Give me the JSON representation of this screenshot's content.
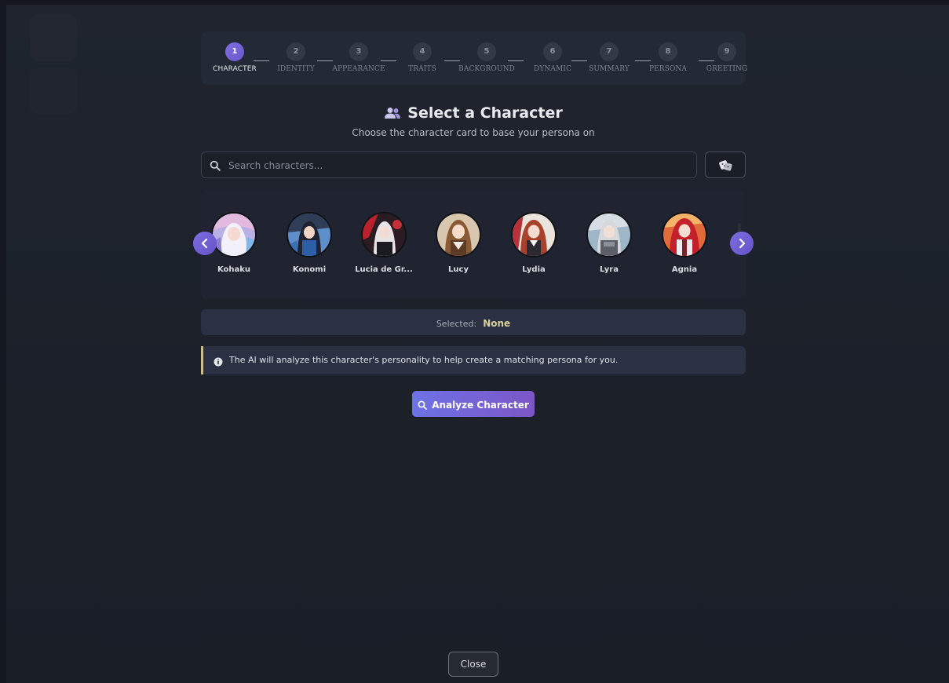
{
  "stepper": {
    "steps": [
      {
        "number": "1",
        "label": "CHARACTER",
        "active": true
      },
      {
        "number": "2",
        "label": "IDENTITY",
        "active": false
      },
      {
        "number": "3",
        "label": "APPEARANCE",
        "active": false
      },
      {
        "number": "4",
        "label": "TRAITS",
        "active": false
      },
      {
        "number": "5",
        "label": "BACKGROUND",
        "active": false
      },
      {
        "number": "6",
        "label": "DYNAMIC",
        "active": false
      },
      {
        "number": "7",
        "label": "SUMMARY",
        "active": false
      },
      {
        "number": "8",
        "label": "PERSONA",
        "active": false
      },
      {
        "number": "9",
        "label": "GREETING",
        "active": false
      }
    ]
  },
  "header": {
    "icon": "users-icon",
    "title": "Select a Character",
    "subtitle": "Choose the character card to base your persona on"
  },
  "search": {
    "placeholder": "Search characters...",
    "value": "",
    "icon": "search-icon",
    "random_icon": "dice-icon"
  },
  "carousel": {
    "prev_icon": "chevron-left-icon",
    "next_icon": "chevron-right-icon",
    "characters": [
      {
        "name": "Kohaku"
      },
      {
        "name": "Konomi"
      },
      {
        "name": "Lucia de Gr..."
      },
      {
        "name": "Lucy"
      },
      {
        "name": "Lydia"
      },
      {
        "name": "Lyra"
      },
      {
        "name": "Agnia"
      }
    ]
  },
  "selection": {
    "label": "Selected:",
    "value": "None"
  },
  "info": {
    "icon": "info-icon",
    "text": "The AI will analyze this character's personality to help create a matching persona for you."
  },
  "actions": {
    "analyze_label": "Analyze Character",
    "analyze_icon": "search-icon",
    "close_label": "Close"
  },
  "colors": {
    "accent": "#7c6ee0",
    "background": "#1f242f",
    "panel": "#232935",
    "selected_value": "#d8cf9e",
    "info_border": "#c9bf8f"
  }
}
